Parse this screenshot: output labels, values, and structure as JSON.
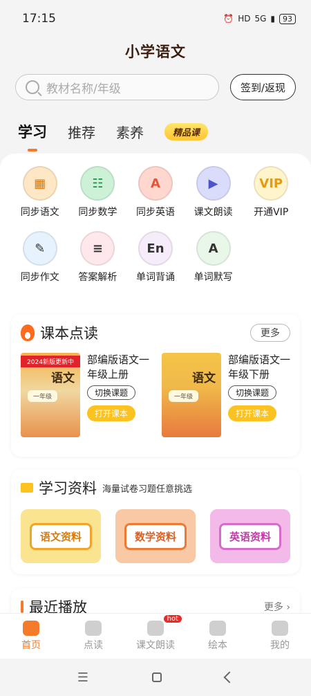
{
  "status_bar": {
    "time": "17:15",
    "hd": "HD",
    "signal": "5G",
    "battery": "93"
  },
  "app": {
    "title": "小学语文"
  },
  "search": {
    "placeholder": "教材名称/年级",
    "checkin_label": "签到/返现"
  },
  "tabs": [
    {
      "label": "学习",
      "active": true
    },
    {
      "label": "推荐",
      "active": false
    },
    {
      "label": "素养",
      "active": false
    }
  ],
  "tab_badge": "精品课",
  "features": [
    {
      "label": "同步语文",
      "icon": "grid-book-icon",
      "glyph": "▦"
    },
    {
      "label": "同步数学",
      "icon": "abacus-icon",
      "glyph": "☷"
    },
    {
      "label": "同步英语",
      "icon": "letter-a-icon",
      "glyph": "A"
    },
    {
      "label": "课文朗读",
      "icon": "play-book-icon",
      "glyph": "▶"
    },
    {
      "label": "开通VIP",
      "icon": "vip-crown-icon",
      "glyph": "VIP"
    },
    {
      "label": "同步作文",
      "icon": "pencil-doc-icon",
      "glyph": "✎"
    },
    {
      "label": "答案解析",
      "icon": "clipboard-icon",
      "glyph": "≡"
    },
    {
      "label": "单词背诵",
      "icon": "en-book-icon",
      "glyph": "En"
    },
    {
      "label": "单词默写",
      "icon": "letter-card-icon",
      "glyph": "A"
    }
  ],
  "textbook_section": {
    "title": "课本点读",
    "more_label": "更多",
    "books": [
      {
        "title": "部编版语文一年级上册",
        "cover_ribbon": "2024新版更新中",
        "cover_name": "语文",
        "cover_grade": "一年级",
        "switch_label": "切换课题",
        "open_label": "打开课本"
      },
      {
        "title": "部编版语文一年级下册",
        "cover_ribbon": "",
        "cover_name": "语文",
        "cover_grade": "一年级",
        "switch_label": "切换课题",
        "open_label": "打开课本"
      }
    ]
  },
  "materials_section": {
    "title": "学习资料",
    "subtitle": "海量试卷习题任意挑选",
    "items": [
      "语文资料",
      "数学资料",
      "英语资料"
    ]
  },
  "recent_section": {
    "title": "最近播放",
    "more_label": "更多 ›"
  },
  "bottom_nav": [
    {
      "label": "首页",
      "active": true,
      "badge": ""
    },
    {
      "label": "点读",
      "active": false,
      "badge": ""
    },
    {
      "label": "课文朗读",
      "active": false,
      "badge": "hot"
    },
    {
      "label": "绘本",
      "active": false,
      "badge": ""
    },
    {
      "label": "我的",
      "active": false,
      "badge": ""
    }
  ],
  "system_nav": {
    "menu_glyph": "☰"
  },
  "colors": {
    "accent": "#f37b2a",
    "gold": "#fcc21f"
  }
}
